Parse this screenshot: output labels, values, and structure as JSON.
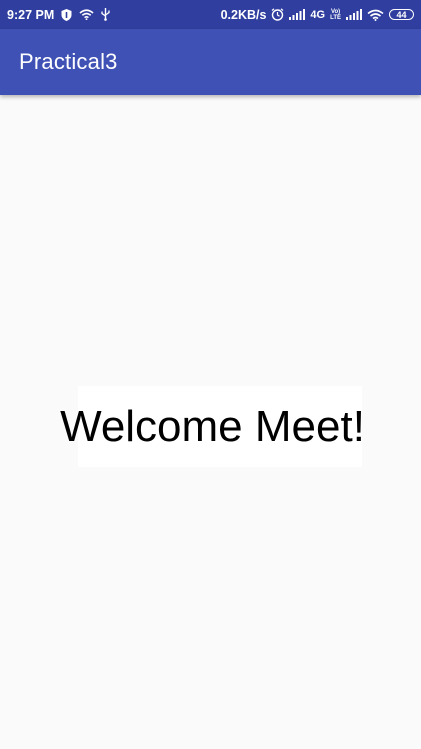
{
  "status_bar": {
    "time": "9:27 PM",
    "network_speed": "0.2KB/s",
    "network_type": "4G",
    "volte_top": "Vo)",
    "volte_bottom": "LTE",
    "battery": "44",
    "icons": [
      "shield-icon",
      "wifi-icon",
      "usb-icon",
      "alarm-icon",
      "signal-icon",
      "signal-icon",
      "wifi-icon",
      "battery-icon"
    ]
  },
  "app_bar": {
    "title": "Practical3",
    "color": "#3f51b5",
    "status_color": "#303f9f"
  },
  "main": {
    "welcome_text": "Welcome Meet!"
  }
}
